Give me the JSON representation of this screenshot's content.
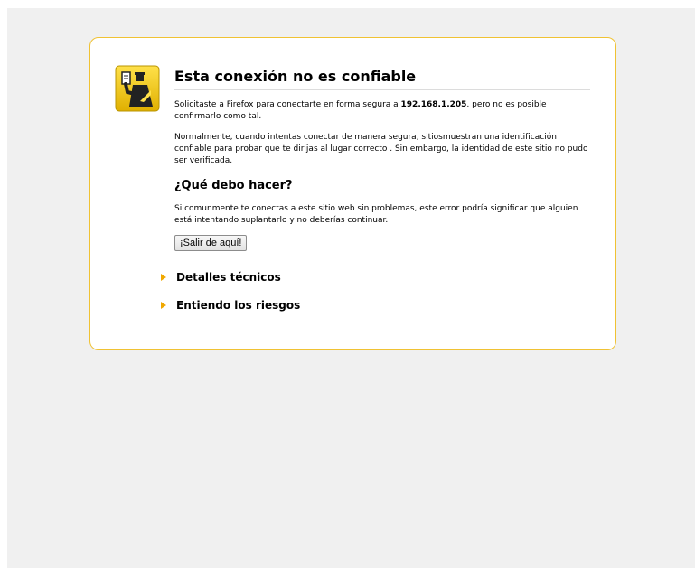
{
  "error": {
    "title": "Esta conexión no es confiable",
    "intro_before": "Solicitaste a Firefox para conectarte en forma segura a ",
    "host": "192.168.1.205",
    "intro_after": ", pero no es posible confirmarlo como tal.",
    "normal_text": "Normalmente, cuando intentas conectar de manera segura, sitiosmuestran una identificación confiable para probar que te dirijas al lugar correcto . Sin embargo, la identidad de este sitio no pudo ser verificada.",
    "what_to_do_heading": "¿Qué debo hacer?",
    "what_to_do_text": "Si comunmente te conectas a este sitio web sin problemas, este error podría significar que alguien está intentando suplantarlo y no deberías continuar.",
    "escape_button_label": "¡Salir de aquí!",
    "expanders": [
      {
        "label": "Detalles técnicos"
      },
      {
        "label": "Entiendo los riesgos"
      }
    ]
  },
  "icons": {
    "cert_icon": "officer-with-certificate-icon",
    "expander_icon": "triangle-right-icon"
  },
  "colors": {
    "box_border": "#f0c233",
    "icon_yellow": "#f2c600",
    "arrow": "#f0a800",
    "page_bg": "#f0f0f0"
  }
}
